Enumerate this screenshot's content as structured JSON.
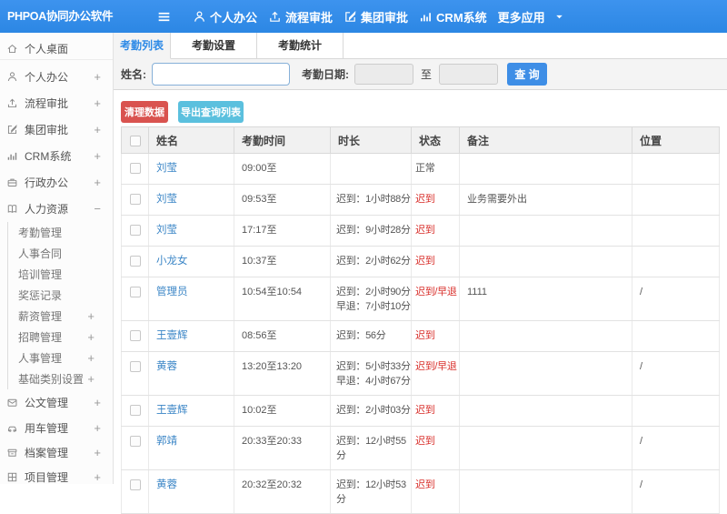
{
  "navbar": {
    "brand": "PHPOA协同办公软件",
    "items": [
      {
        "label": "个人办公",
        "icon": "user-icon"
      },
      {
        "label": "流程审批",
        "icon": "share-icon"
      },
      {
        "label": "集团审批",
        "icon": "edit-icon"
      },
      {
        "label": "CRM系统",
        "icon": "chart-icon"
      },
      {
        "label": "更多应用",
        "icon": "caret-down-icon"
      }
    ]
  },
  "sidebar": {
    "items": [
      {
        "label": "个人桌面",
        "icon": "home-icon",
        "toggle": ""
      },
      {
        "label": "个人办公",
        "icon": "user-icon",
        "toggle": "+"
      },
      {
        "label": "流程审批",
        "icon": "share-icon",
        "toggle": "+"
      },
      {
        "label": "集团审批",
        "icon": "edit-icon",
        "toggle": "+"
      },
      {
        "label": "CRM系统",
        "icon": "chart-icon",
        "toggle": "+"
      },
      {
        "label": "行政办公",
        "icon": "briefcase-icon",
        "toggle": "+"
      },
      {
        "label": "人力资源",
        "icon": "book-icon",
        "toggle": "−",
        "children": [
          {
            "label": "考勤管理",
            "toggle": ""
          },
          {
            "label": "人事合同",
            "toggle": ""
          },
          {
            "label": "培训管理",
            "toggle": ""
          },
          {
            "label": "奖惩记录",
            "toggle": ""
          },
          {
            "label": "薪资管理",
            "toggle": "+"
          },
          {
            "label": "招聘管理",
            "toggle": "+"
          },
          {
            "label": "人事管理",
            "toggle": "+"
          },
          {
            "label": "基础类别设置",
            "toggle": "+"
          }
        ]
      },
      {
        "label": "公文管理",
        "icon": "document-icon",
        "toggle": "+"
      },
      {
        "label": "用车管理",
        "icon": "car-icon",
        "toggle": "+"
      },
      {
        "label": "档案管理",
        "icon": "archive-icon",
        "toggle": "+"
      },
      {
        "label": "项目管理",
        "icon": "grid-icon",
        "toggle": "+"
      }
    ]
  },
  "tabs": [
    {
      "label": "考勤列表",
      "active": true
    },
    {
      "label": "考勤设置",
      "active": false
    },
    {
      "label": "考勤统计",
      "active": false
    }
  ],
  "filter": {
    "name_label": "姓名:",
    "name_value": "",
    "date_label": "考勤日期:",
    "date_from": "",
    "date_to": "",
    "to_label": "至",
    "query_button": "查 询"
  },
  "actions": {
    "clean_button": "清理数据",
    "export_button": "导出查询列表"
  },
  "table": {
    "columns": [
      "姓名",
      "考勤时间",
      "时长",
      "状态",
      "备注",
      "位置"
    ],
    "rows": [
      {
        "name": "刘莹",
        "time": "09:00至",
        "dur1": "",
        "dur2": "",
        "status": "正常",
        "status_red": false,
        "remark": "",
        "location": ""
      },
      {
        "name": "刘莹",
        "time": "09:53至",
        "dur1": "迟到：1小时88分",
        "dur2": "",
        "status": "迟到",
        "status_red": true,
        "remark": "业务需要外出",
        "location": ""
      },
      {
        "name": "刘莹",
        "time": "17:17至",
        "dur1": "迟到：9小时28分",
        "dur2": "",
        "status": "迟到",
        "status_red": true,
        "remark": "",
        "location": ""
      },
      {
        "name": "小龙女",
        "time": "10:37至",
        "dur1": "迟到：2小时62分",
        "dur2": "",
        "status": "迟到",
        "status_red": true,
        "remark": "",
        "location": ""
      },
      {
        "name": "管理员",
        "time": "10:54至10:54",
        "dur1": "迟到：2小时90分",
        "dur2": "早退：7小时10分",
        "status": "迟到/早退",
        "status_red": true,
        "remark": "1111",
        "location": "/"
      },
      {
        "name": "王壹辉",
        "time": "08:56至",
        "dur1": "迟到：56分",
        "dur2": "",
        "status": "迟到",
        "status_red": true,
        "remark": "",
        "location": ""
      },
      {
        "name": "黄蓉",
        "time": "13:20至13:20",
        "dur1": "迟到：5小时33分",
        "dur2": "早退：4小时67分",
        "status": "迟到/早退",
        "status_red": true,
        "remark": "",
        "location": "/"
      },
      {
        "name": "王壹辉",
        "time": "10:02至",
        "dur1": "迟到：2小时03分",
        "dur2": "",
        "status": "迟到",
        "status_red": true,
        "remark": "",
        "location": ""
      },
      {
        "name": "郭靖",
        "time": "20:33至20:33",
        "dur1": "迟到：12小时55分",
        "dur2": "",
        "status": "迟到",
        "status_red": true,
        "remark": "",
        "location": "/"
      },
      {
        "name": "黄蓉",
        "time": "20:32至20:32",
        "dur1": "迟到：12小时53分",
        "dur2": "",
        "status": "迟到",
        "status_red": true,
        "remark": "",
        "location": "/"
      }
    ]
  },
  "colors": {
    "navbar": "#2e8ae6",
    "tab_active_text": "#2e8ae6",
    "link": "#3a85c6",
    "status_red": "#d9302c",
    "btn_query": "#3e8ee6",
    "btn_danger": "#d9534f",
    "btn_info": "#5bc0de"
  }
}
